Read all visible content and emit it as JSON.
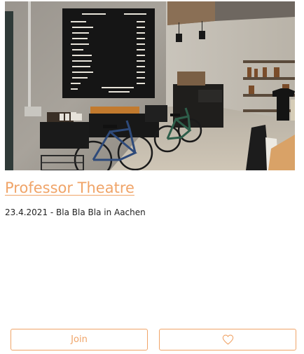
{
  "event": {
    "title": "Professor Theatre",
    "meta": "23.4.2021 - Bla Bla Bla in Aachen"
  },
  "image": {
    "subject": "cafe interior with departures board and bicycles",
    "board_header_left": "DESTINATION",
    "board_header_right": "DEPARTURE",
    "board_footer": "SEE SIGNATURE MENU"
  },
  "actions": {
    "join_label": "Join",
    "like_icon": "heart-outline-icon"
  },
  "colors": {
    "accent": "#f0a468",
    "text": "#222222"
  }
}
